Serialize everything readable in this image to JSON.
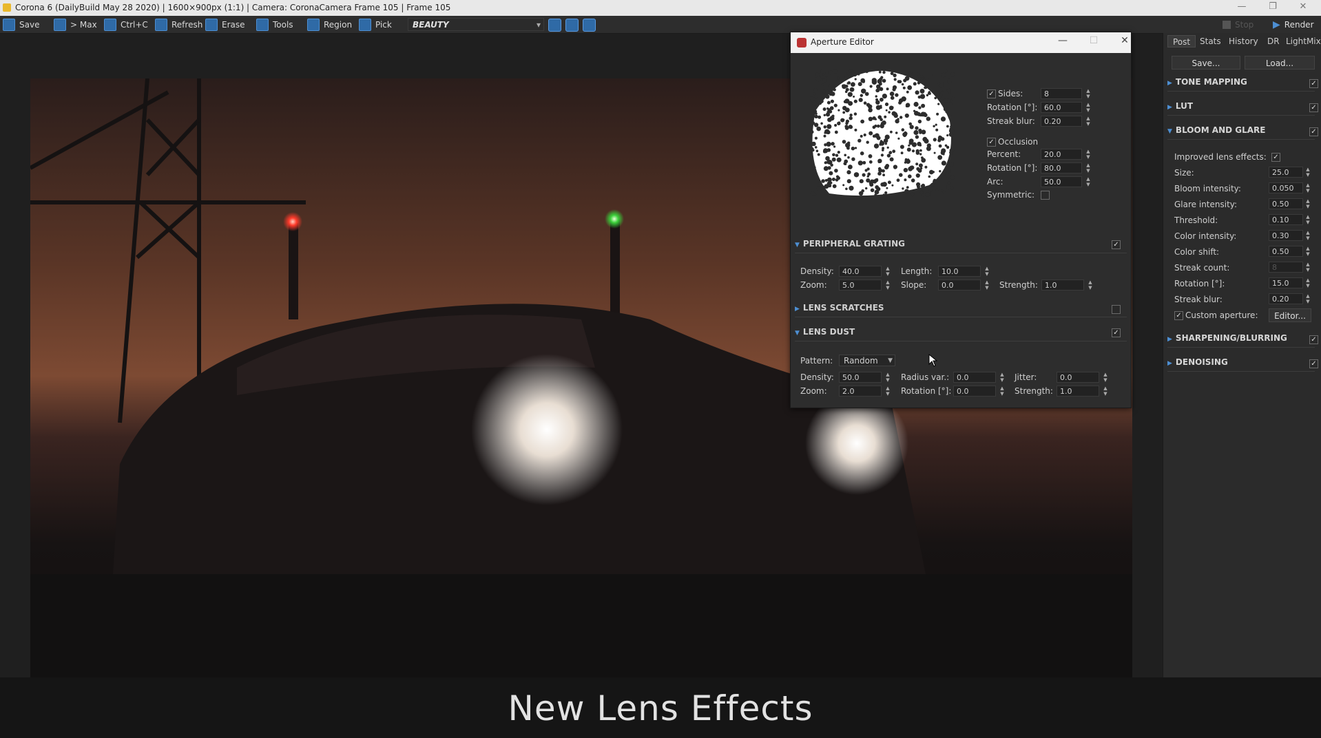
{
  "window": {
    "title": "Corona 6 (DailyBuild May 28 2020) | 1600×900px (1:1) | Camera: CoronaCamera Frame 105 | Frame 105"
  },
  "toolbar": {
    "save": "Save",
    "max": "> Max",
    "copy": "Ctrl+C",
    "refresh": "Refresh",
    "erase": "Erase",
    "tools": "Tools",
    "region": "Region",
    "pick": "Pick",
    "pass": "BEAUTY",
    "stop": "Stop",
    "render": "Render"
  },
  "caption": "New Lens Effects",
  "aperture_editor": {
    "title": "Aperture Editor",
    "sides_label": "Sides:",
    "sides": "8",
    "rotation_label": "Rotation [°]:",
    "rotation": "60.0",
    "streak_blur_label": "Streak blur:",
    "streak_blur": "0.20",
    "occlusion_label": "Occlusion",
    "percent_label": "Percent:",
    "percent": "20.0",
    "occ_rotation_label": "Rotation [°]:",
    "occ_rotation": "80.0",
    "arc_label": "Arc:",
    "arc": "50.0",
    "symmetric_label": "Symmetric:",
    "peripheral": {
      "title": "PERIPHERAL GRATING",
      "density_label": "Density:",
      "density": "40.0",
      "length_label": "Length:",
      "length": "10.0",
      "zoom_label": "Zoom:",
      "zoom": "5.0",
      "slope_label": "Slope:",
      "slope": "0.0",
      "strength_label": "Strength:",
      "strength": "1.0"
    },
    "scratches": {
      "title": "LENS SCRATCHES"
    },
    "dust": {
      "title": "LENS DUST",
      "pattern_label": "Pattern:",
      "pattern": "Random",
      "density_label": "Density:",
      "density": "50.0",
      "radius_label": "Radius var.:",
      "radius": "0.0",
      "jitter_label": "Jitter:",
      "jitter": "0.0",
      "zoom_label": "Zoom:",
      "zoom": "2.0",
      "rotation_label": "Rotation [°]:",
      "rotation": "0.0",
      "strength_label": "Strength:",
      "strength": "1.0"
    }
  },
  "right_panel": {
    "tabs": [
      "Post",
      "Stats",
      "History",
      "DR",
      "LightMix"
    ],
    "save_btn": "Save...",
    "load_btn": "Load...",
    "sections": {
      "tone_mapping": "TONE MAPPING",
      "lut": "LUT",
      "bloom": "BLOOM AND GLARE",
      "sharpening": "SHARPENING/BLURRING",
      "denoising": "DENOISING"
    },
    "bloom": {
      "improved_label": "Improved lens effects:",
      "size_label": "Size:",
      "size": "25.0",
      "bloom_intensity_label": "Bloom intensity:",
      "bloom_intensity": "0.050",
      "glare_intensity_label": "Glare intensity:",
      "glare_intensity": "0.50",
      "threshold_label": "Threshold:",
      "threshold": "0.10",
      "color_intensity_label": "Color intensity:",
      "color_intensity": "0.30",
      "color_shift_label": "Color shift:",
      "color_shift": "0.50",
      "streak_count_label": "Streak count:",
      "streak_count": "8",
      "rotation_label": "Rotation [°]:",
      "rotation": "15.0",
      "streak_blur_label": "Streak blur:",
      "streak_blur": "0.20",
      "custom_aperture_label": "Custom aperture:",
      "editor_btn": "Editor..."
    }
  },
  "colors": {
    "accent": "#4d8fd3",
    "panel": "#2d2d2d",
    "checkmark": "#dddddd"
  }
}
